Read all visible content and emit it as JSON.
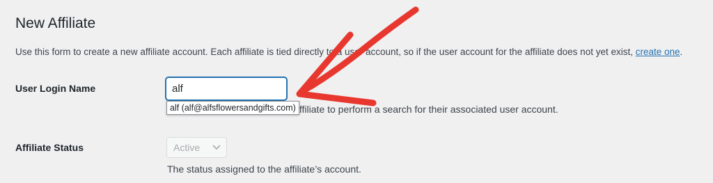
{
  "page": {
    "title": "New Affiliate",
    "intro_text": "Use this form to create a new affiliate account. Each affiliate is tied directly to a user account, so if the user account for the affiliate does not yet exist,",
    "intro_link": "create one",
    "intro_end": "."
  },
  "login": {
    "label": "User Login Name",
    "value": "alf",
    "description": "Begin typing the name of the affiliate to perform a search for their associated user account.",
    "suggestion": "alf (alf@alfsflowersandgifts.com)"
  },
  "status": {
    "label": "Affiliate Status",
    "selected": "Active",
    "description": "The status assigned to the affiliate’s account."
  },
  "colors": {
    "arrow": "#e8372e",
    "link": "#2271b1",
    "focus_border": "#2271b1"
  },
  "icons": {
    "select_chevron": "chevron-down-icon",
    "annotation": "red-arrow"
  }
}
